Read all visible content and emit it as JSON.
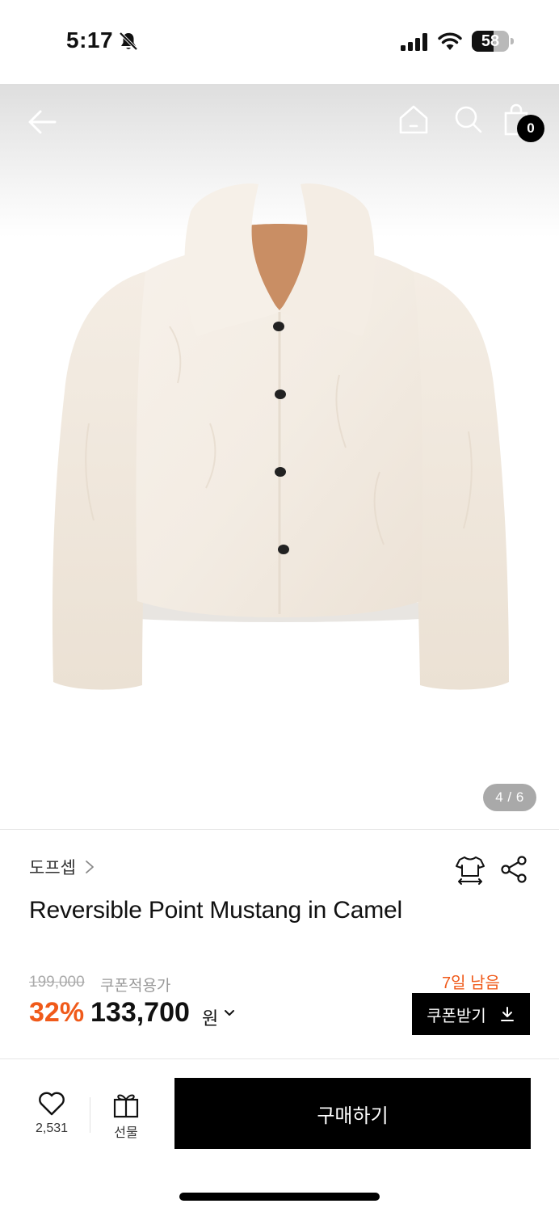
{
  "status_bar": {
    "time": "5:17",
    "battery": "58",
    "battery_level": 0.58
  },
  "nav": {
    "cart_count": "0"
  },
  "gallery": {
    "page_indicator": "4 / 6",
    "current": 4,
    "total": 6
  },
  "product": {
    "brand": "도프셉",
    "title": "Reversible Point Mustang in Camel",
    "original_price": "199,000",
    "coupon_applied_label": "쿠폰적용가",
    "discount": "32%",
    "sale_price": "133,700",
    "currency": "원"
  },
  "coupon": {
    "days_left": "7일 남음",
    "button_label": "쿠폰받기"
  },
  "actions": {
    "like_count": "2,531",
    "gift_label": "선물",
    "buy_label": "구매하기"
  },
  "colors": {
    "accent": "#f05a1a",
    "primary_button": "#000000"
  },
  "icons": [
    "bell-slash-icon",
    "signal-icon",
    "wifi-icon",
    "battery-icon",
    "back-arrow-icon",
    "home-icon",
    "search-icon",
    "shopping-bag-icon",
    "chevron-right-icon",
    "size-guide-icon",
    "share-icon",
    "chevron-down-icon",
    "download-icon",
    "heart-icon",
    "gift-icon"
  ]
}
